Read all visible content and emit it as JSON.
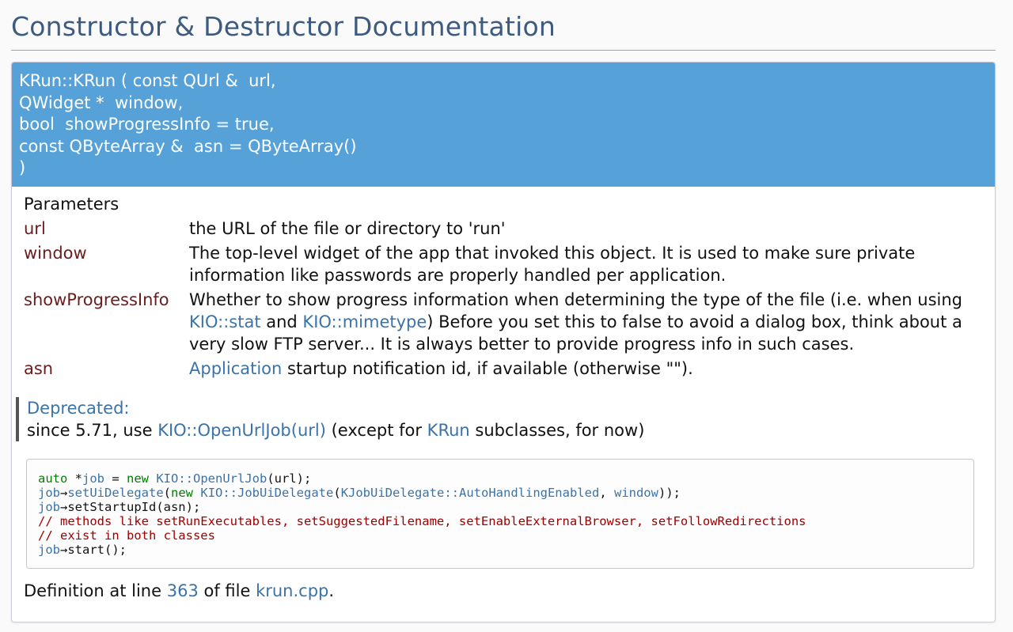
{
  "header": {
    "title": "Constructor & Destructor Documentation"
  },
  "prototype": {
    "lines": [
      "KRun::KRun ( const QUrl &  url,",
      "QWidget *  window,",
      "bool  showProgressInfo = true,",
      "const QByteArray &  asn = QByteArray()",
      ")"
    ]
  },
  "params": {
    "title": "Parameters",
    "url": {
      "name": "url",
      "desc": "the URL of the file or directory to 'run'"
    },
    "window": {
      "name": "window",
      "desc": "The top-level widget of the app that invoked this object. It is used to make sure private information like passwords are properly handled per application."
    },
    "showProgressInfo": {
      "name": "showProgressInfo",
      "desc_pre": "Whether to show progress information when determining the type of the file (i.e. when using ",
      "link1": "KIO::stat",
      "mid": " and ",
      "link2": "KIO::mimetype",
      "desc_post": ") Before you set this to false to avoid a dialog box, think about a very slow FTP server... It is always better to provide progress info in such cases."
    },
    "asn": {
      "name": "asn",
      "link": "Application",
      "desc": " startup notification id, if available (otherwise \"\")."
    }
  },
  "deprecated": {
    "title": "Deprecated:",
    "pre": "since 5.71, use ",
    "link1": "KIO::OpenUrlJob(url)",
    "mid": " (except for ",
    "link2": "KRun",
    "post": " subclasses, for now)"
  },
  "code": {
    "l1": {
      "kw1": "auto",
      "p1": " *",
      "var": "job",
      "p2": " = ",
      "kw2": "new",
      "p3": " ",
      "cls": "KIO::OpenUrlJob",
      "p4": "(url);"
    },
    "l2": {
      "var": "job",
      "p1": "→",
      "fn": "setUiDelegate",
      "p2": "(",
      "kw": "new",
      "p3": " ",
      "cls1": "KIO::JobUiDelegate",
      "p4": "(",
      "cls2": "KJobUiDelegate::AutoHandlingEnabled",
      "p5": ", ",
      "win": "window",
      "p6": "));"
    },
    "l3": {
      "var": "job",
      "p1": "→setStartupId(asn);"
    },
    "l4": "// methods like setRunExecutables, setSuggestedFilename, setEnableExternalBrowser, setFollowRedirections",
    "l5": "// exist in both classes",
    "l6": {
      "var": "job",
      "p1": "→start();"
    }
  },
  "definition": {
    "pre": "Definition at line ",
    "line": "363",
    "mid": " of file ",
    "file": "krun.cpp",
    "post": "."
  }
}
